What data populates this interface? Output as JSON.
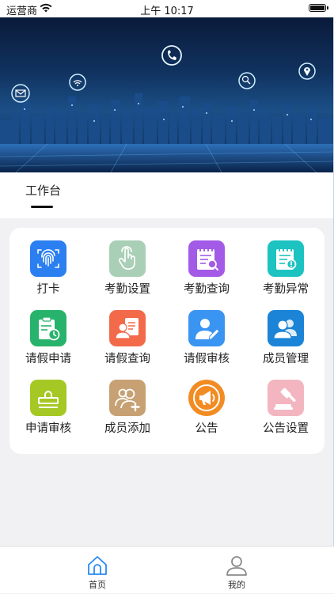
{
  "status_bar": {
    "carrier": "运营商",
    "time": "上午 10:17"
  },
  "workbench": {
    "title": "工作台"
  },
  "colors": {
    "accent": "#2a8bf2",
    "card_bg": "#ffffff",
    "page_bg": "#f1f1f3"
  },
  "grid": {
    "items": [
      {
        "label": "打卡",
        "icon": "fingerprint-icon",
        "color": "#2b7ff0"
      },
      {
        "label": "考勤设置",
        "icon": "hand-pointer-icon",
        "color": "#a9cfb6"
      },
      {
        "label": "考勤查询",
        "icon": "notepad-search-icon",
        "color": "#a35ae6"
      },
      {
        "label": "考勤异常",
        "icon": "notepad-alert-icon",
        "color": "#1cc3c1"
      },
      {
        "label": "请假申请",
        "icon": "clipboard-clock-icon",
        "color": "#27b36b"
      },
      {
        "label": "请假查询",
        "icon": "user-doc-icon",
        "color": "#f26a4a"
      },
      {
        "label": "请假审核",
        "icon": "user-edit-icon",
        "color": "#3a94f2"
      },
      {
        "label": "成员管理",
        "icon": "users-icon",
        "color": "#1b84d6"
      },
      {
        "label": "申请审核",
        "icon": "stamp-icon",
        "color": "#a6c824"
      },
      {
        "label": "成员添加",
        "icon": "user-add-icon",
        "color": "#c7a173"
      },
      {
        "label": "公告",
        "icon": "megaphone-icon",
        "color": "#f28c22"
      },
      {
        "label": "公告设置",
        "icon": "gavel-icon",
        "color": "#f3b6c0"
      }
    ]
  },
  "tabbar": {
    "home_label": "首页",
    "mine_label": "我的"
  }
}
